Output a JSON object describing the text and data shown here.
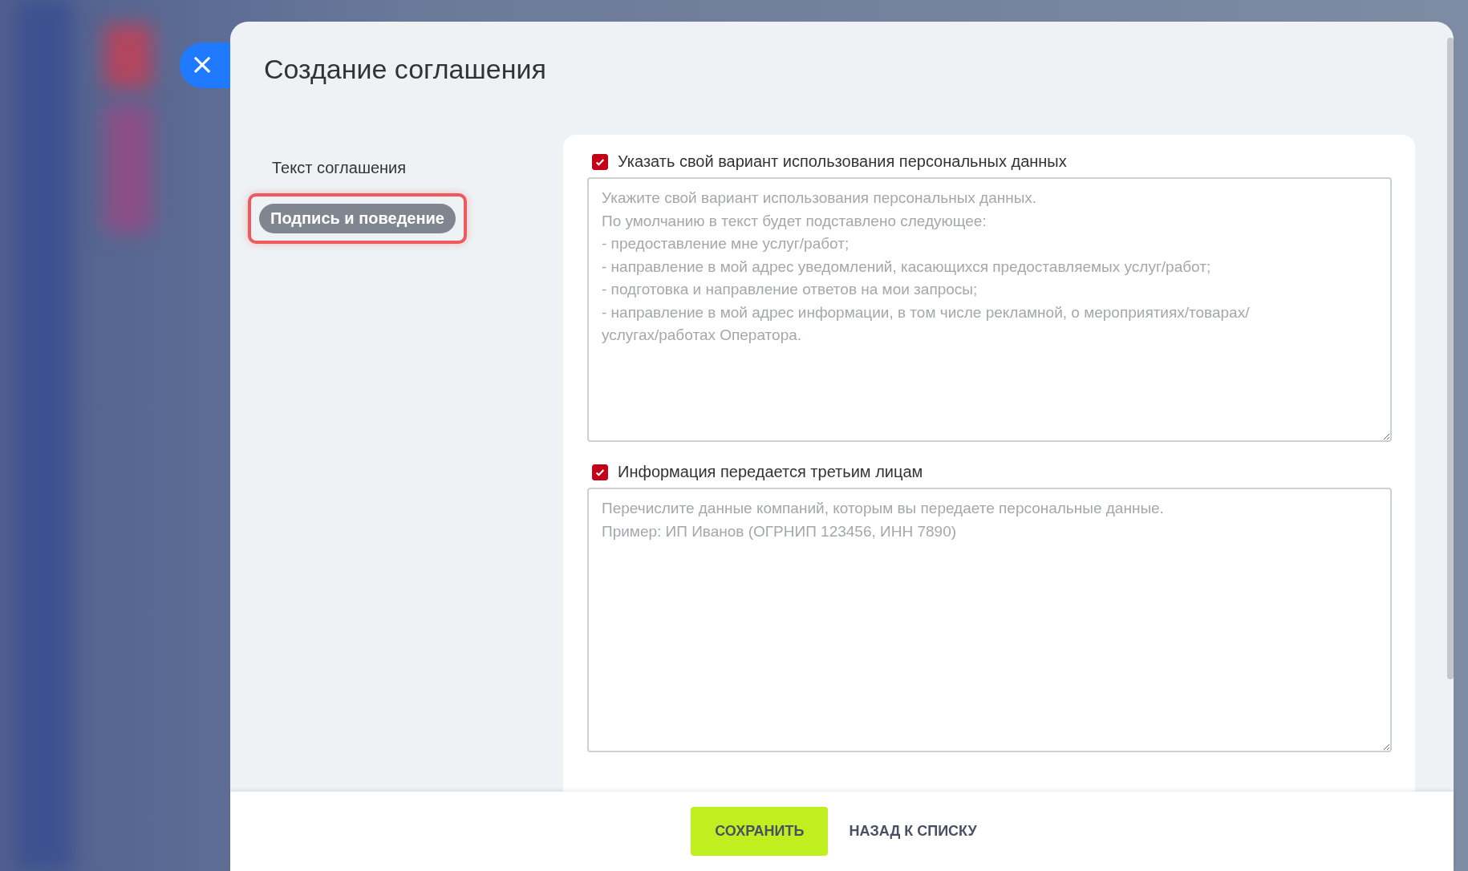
{
  "close_button": {
    "label": "×"
  },
  "window": {
    "title": "Создание соглашения"
  },
  "sidebar": {
    "items": [
      {
        "label": "Текст соглашения",
        "selected": false
      },
      {
        "label": "Подпись и поведение",
        "selected": true
      }
    ]
  },
  "fields": [
    {
      "label": "Указать свой вариант использования персональных данных",
      "checked": true,
      "placeholder": "Укажите свой вариант использования персональных данных.\nПо умолчанию в текст будет подставлено следующее:\n- предоставление мне услуг/работ;\n- направление в мой адрес уведомлений, касающихся предоставляемых услуг/работ;\n- подготовка и направление ответов на мои запросы;\n- направление в мой адрес информации, в том числе рекламной, о мероприятиях/товарах/\nуслугах/работах Оператора."
    },
    {
      "label": "Информация передается третьим лицам",
      "checked": true,
      "placeholder": "Перечислите данные компаний, которым вы передаете персональные данные.\nПример: ИП Иванов (ОГРНИП 123456, ИНН 7890)"
    }
  ],
  "footer": {
    "buttons": [
      {
        "label": "СОХРАНИТЬ",
        "kind": "primary"
      },
      {
        "label": "НАЗАД К СПИСКУ",
        "kind": "link"
      }
    ]
  }
}
